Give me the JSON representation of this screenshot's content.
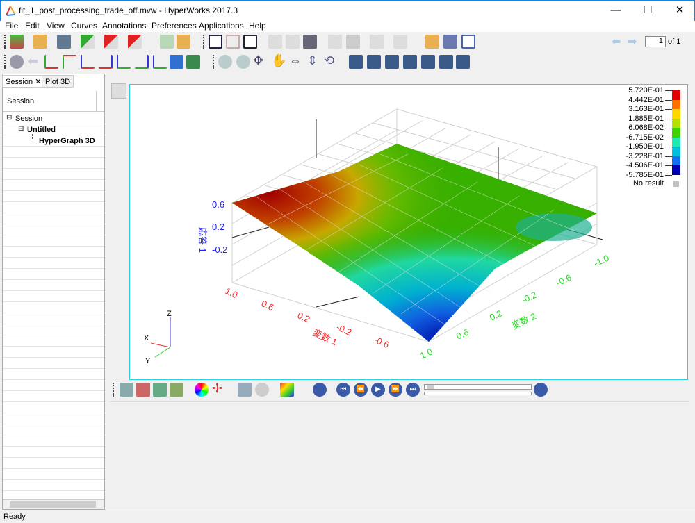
{
  "window": {
    "title": "fit_1_post_processing_trade_off.mvw - HyperWorks 2017.3",
    "minimize": "—",
    "maximize": "☐",
    "close": "✕"
  },
  "menu": [
    "File",
    "Edit",
    "View",
    "Curves",
    "Annotations",
    "Preferences",
    "Applications",
    "Help"
  ],
  "page_nav": {
    "current": "1",
    "of_label": "of 1"
  },
  "left_panel": {
    "tabs": [
      "Session",
      "Plot 3D"
    ],
    "header": "Session",
    "tree": [
      {
        "label": "Session"
      },
      {
        "label": "Untitled"
      },
      {
        "label": "HyperGraph 3D"
      }
    ]
  },
  "plot": {
    "z_axis_label": "応答 1",
    "z_ticks": [
      "0.6",
      "0.2",
      "-0.2"
    ],
    "x_axis_label": "変数 1",
    "x_ticks": [
      "1.0",
      "0.6",
      "0.2",
      "-0.2",
      "-0.6"
    ],
    "y_axis_label": "変数 2",
    "y_ticks": [
      "1.0",
      "0.6",
      "0.2",
      "-0.2",
      "-0.6",
      "-1.0"
    ],
    "triad": {
      "x": "X",
      "y": "Y",
      "z": "Z"
    }
  },
  "legend": {
    "values": [
      "5.720E-01",
      "4.442E-01",
      "3.163E-01",
      "1.885E-01",
      "6.068E-02",
      "-6.715E-02",
      "-1.950E-01",
      "-3.228E-01",
      "-4.506E-01",
      "-5.785E-01"
    ],
    "colors": [
      "#e00000",
      "#ff7000",
      "#ffd800",
      "#b4e000",
      "#40d000",
      "#20e8b0",
      "#00c0d8",
      "#1070f0",
      "#0000b0"
    ],
    "no_result": "No result",
    "no_result_color": "#c0c0c0"
  },
  "status": {
    "text": "Ready"
  }
}
